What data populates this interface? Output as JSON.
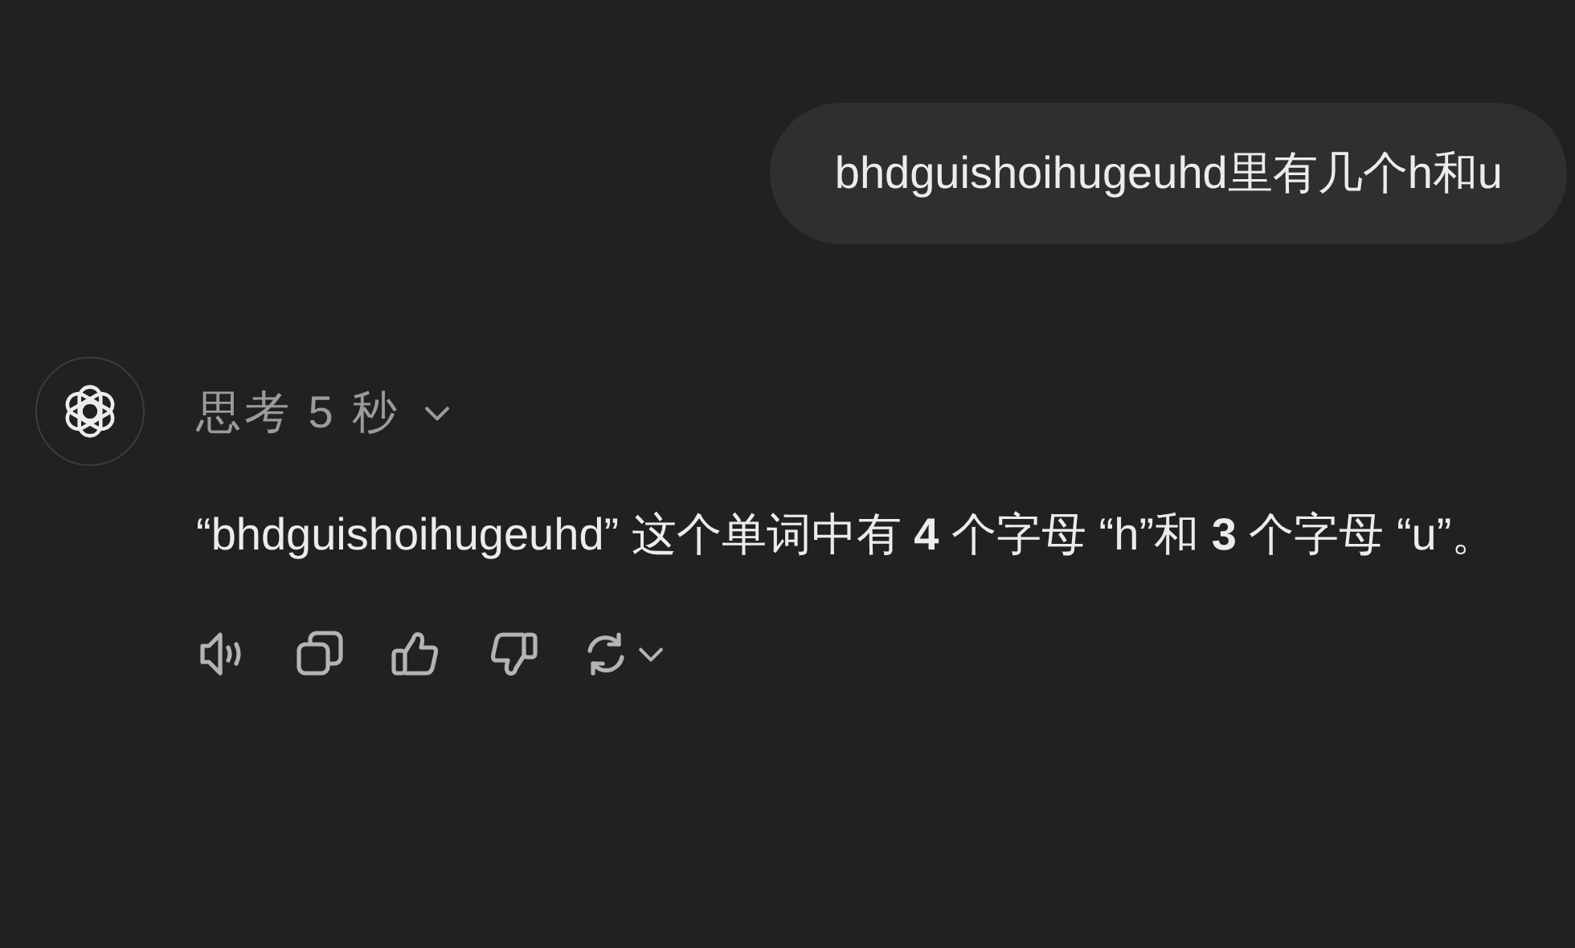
{
  "user_message": {
    "text": "bhdguishoihugeuhd里有几个h和u"
  },
  "assistant": {
    "thinking_label": "思考 5 秒",
    "answer": "“bhdguishoihugeuhd” 这个单词中有 **4** 个字母 “h”和 **3** 个字母 “u”。"
  }
}
